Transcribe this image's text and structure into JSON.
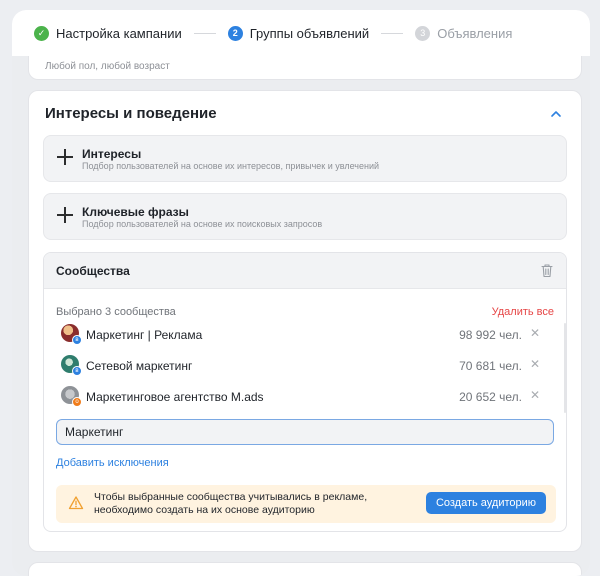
{
  "stepper": {
    "steps": [
      {
        "label": "Настройка кампании",
        "state": "done",
        "num": "✓"
      },
      {
        "label": "Группы объявлений",
        "state": "active",
        "num": "2"
      },
      {
        "label": "Объявления",
        "state": "todo",
        "num": "3"
      }
    ]
  },
  "prev_card": {
    "subtitle": "Любой пол, любой возраст"
  },
  "interests": {
    "title": "Интересы и поведение",
    "options": [
      {
        "title": "Интересы",
        "desc": "Подбор пользователей на основе их интересов, привычек и увлечений"
      },
      {
        "title": "Ключевые фразы",
        "desc": "Подбор пользователей на основе их поисковых запросов"
      }
    ],
    "communities": {
      "title": "Сообщества",
      "selected_count": "Выбрано 3 сообщества",
      "remove_all": "Удалить все",
      "items": [
        {
          "name": "Маркетинг | Реклама",
          "count": "98 992 чел.",
          "badge": "vk-icon"
        },
        {
          "name": "Сетевой маркетинг",
          "count": "70 681 чел.",
          "badge": "vk-icon"
        },
        {
          "name": "Маркетинговое агентство M.ads",
          "count": "20 652 чел.",
          "badge": "ok-icon"
        }
      ],
      "search_value": "Маркетинг",
      "add_exclusions": "Добавить исключения",
      "notice_text": "Чтобы выбранные сообщества учитывались в рекламе, необходимо создать на их основе аудиторию",
      "create_audience": "Создать аудиторию"
    }
  },
  "colors": {
    "accent": "#2d81e0",
    "success": "#4bb34b",
    "danger": "#e64646",
    "warning_bg": "#fff3e0"
  }
}
